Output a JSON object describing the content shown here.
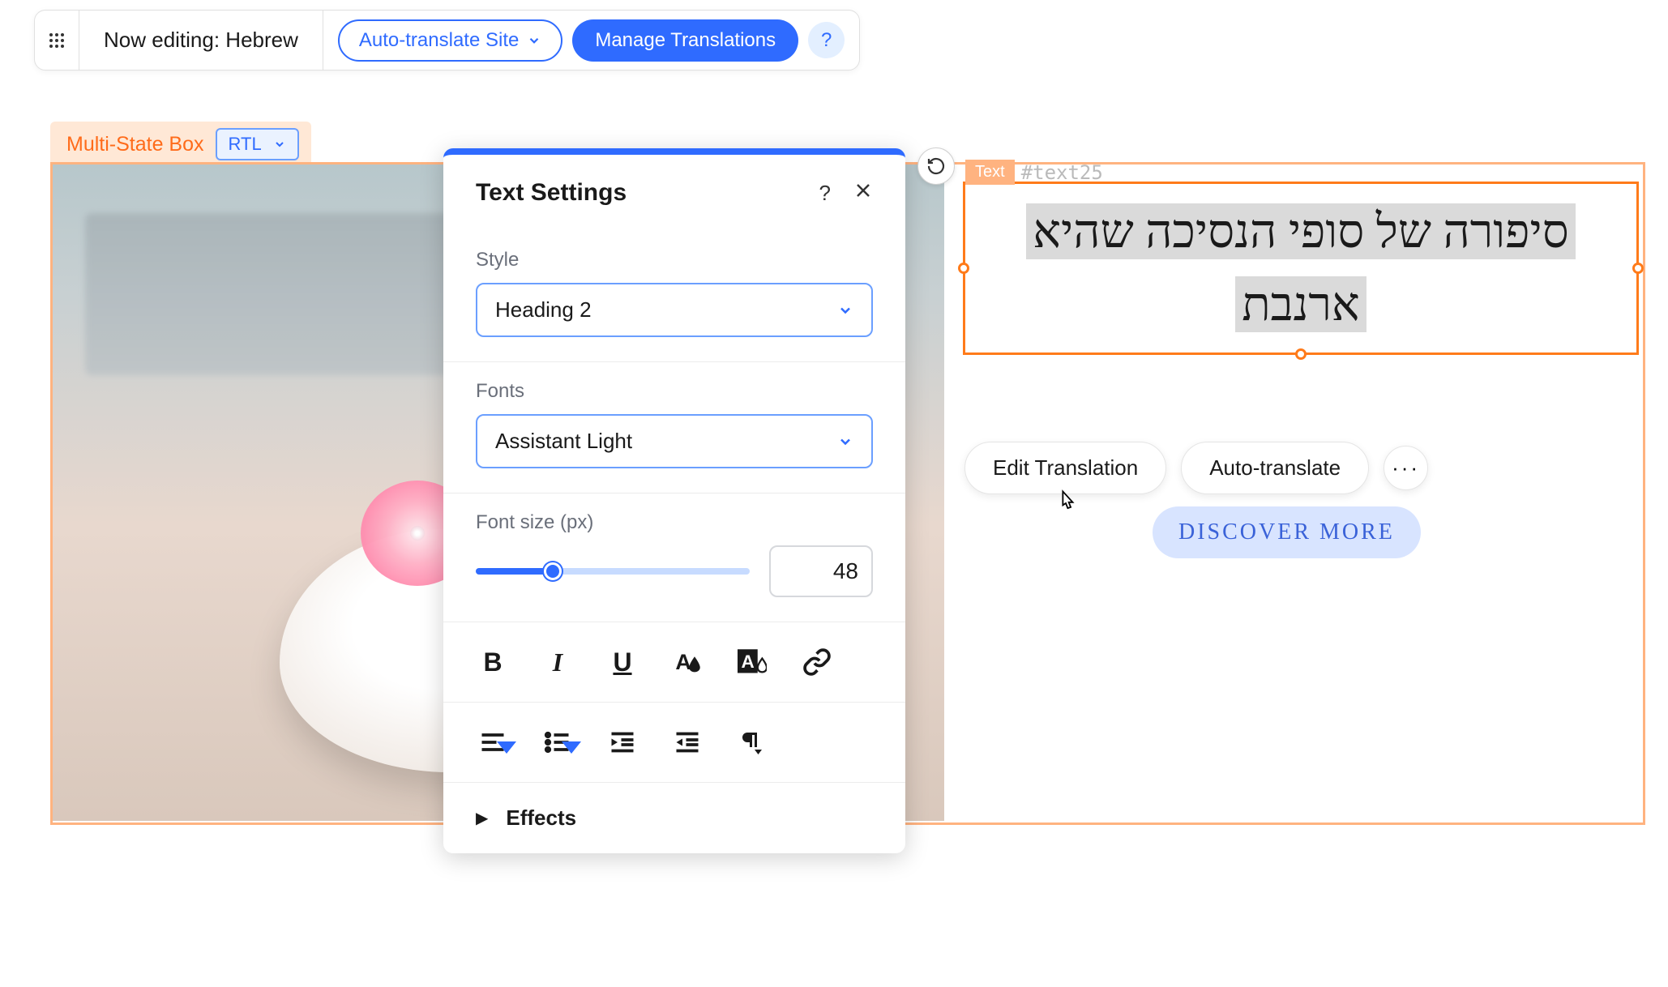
{
  "toolbar": {
    "editing_label": "Now editing: Hebrew",
    "auto_translate_label": "Auto-translate Site",
    "manage_label": "Manage Translations",
    "help": "?"
  },
  "element_label": {
    "name": "Multi-State Box",
    "rtl_label": "RTL"
  },
  "text_settings": {
    "title": "Text Settings",
    "help": "?",
    "style_label": "Style",
    "style_value": "Heading 2",
    "fonts_label": "Fonts",
    "font_value": "Assistant Light",
    "fontsize_label": "Font size (px)",
    "fontsize_value": "48",
    "effects_label": "Effects"
  },
  "text_element": {
    "badge": "Text",
    "id": "#text25",
    "content": "סיפורה של סופי הנסיכה שהיא ארנבת"
  },
  "context": {
    "edit_translation": "Edit Translation",
    "auto_translate": "Auto-translate",
    "more": "···"
  },
  "discover": {
    "label": "DISCOVER MORE"
  }
}
